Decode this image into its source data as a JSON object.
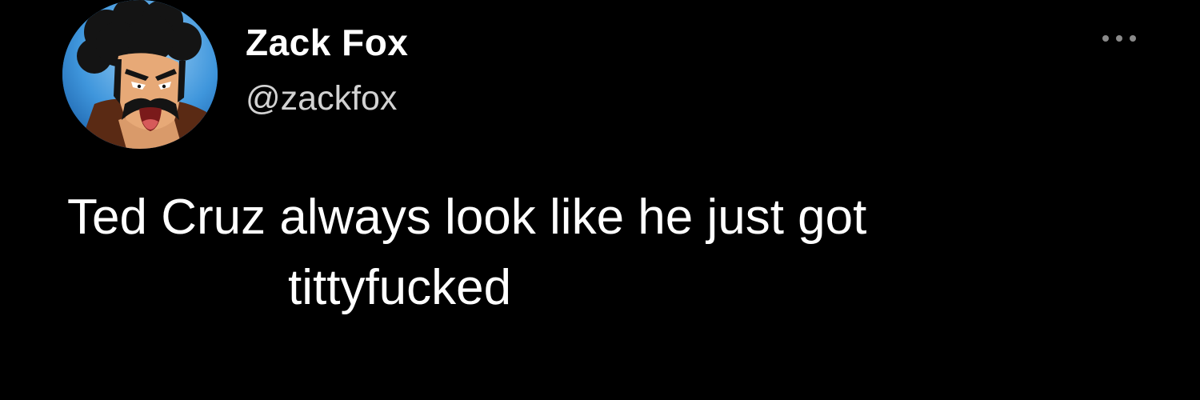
{
  "tweet": {
    "display_name": "Zack Fox",
    "handle": "@zackfox",
    "text_line_1": "Ted Cruz always look like he just got",
    "text_line_2": "tittyfucked"
  },
  "avatar": {
    "icon": "profile-avatar-cartoon-man"
  },
  "more_button": {
    "icon": "more-horizontal-icon"
  },
  "colors": {
    "background": "#000000",
    "primary_text": "#ffffff",
    "secondary_text": "#d2d2d2",
    "icon_gray": "#8a8a8a"
  }
}
